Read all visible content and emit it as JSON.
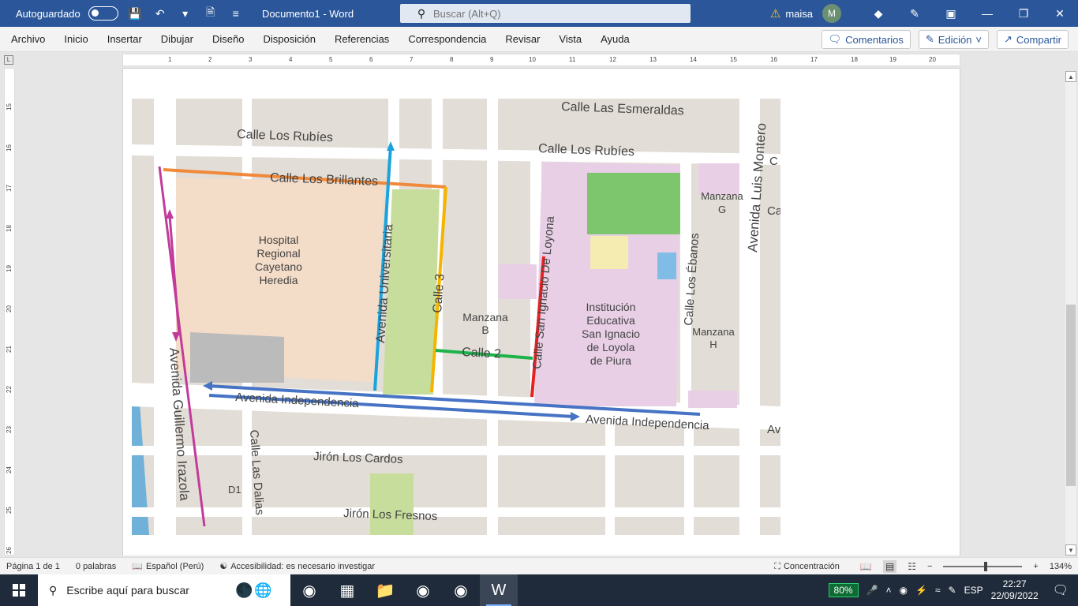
{
  "titlebar": {
    "autosave_label": "Autoguardado",
    "doc_title": "Documento1  -  Word",
    "search_placeholder": "Buscar (Alt+Q)",
    "user_name": "maisa",
    "avatar_initial": "M"
  },
  "ribbon": {
    "tabs": [
      "Archivo",
      "Inicio",
      "Insertar",
      "Dibujar",
      "Diseño",
      "Disposición",
      "Referencias",
      "Correspondencia",
      "Revisar",
      "Vista",
      "Ayuda"
    ],
    "comments_label": "Comentarios",
    "edit_label": "Edición",
    "share_label": "Compartir"
  },
  "ruler": {
    "h_numbers": [
      "1",
      "2",
      "3",
      "4",
      "5",
      "6",
      "7",
      "8",
      "9",
      "10",
      "11",
      "12",
      "13",
      "14",
      "15",
      "16",
      "17",
      "18",
      "19",
      "20"
    ],
    "v_numbers": [
      "15",
      "16",
      "17",
      "18",
      "19",
      "20",
      "21",
      "22",
      "23",
      "24",
      "25",
      "26"
    ]
  },
  "map": {
    "labels": {
      "esmeraldas": "Calle Las Esmeraldas",
      "rubies_1": "Calle Los Rubíes",
      "rubies_2": "Calle Los Rubíes",
      "brillantes": "Calle Los Brillantes",
      "hospital": [
        "Hospital",
        "Regional",
        "Cayetano",
        "Heredia"
      ],
      "universitaria": "Avenida Universitaria",
      "calle3": "Calle 3",
      "manzana_b": [
        "Manzana",
        "B"
      ],
      "calle2": "Calle 2",
      "san_ignacio_street": "Calle San Ignacio De Loyona",
      "institucion": [
        "Institución",
        "Educativa",
        "San Ignacio",
        "de Loyola",
        "de Piura"
      ],
      "ebanos": "Calle Los Ébanos",
      "manzana_g": [
        "Manzana",
        "G"
      ],
      "manzana_h": [
        "Manzana",
        "H"
      ],
      "luis_montero": "Avenida Luis Montero",
      "independencia_1": "Avenida Independencia",
      "independencia_2": "Avenida Independencia",
      "irazola": "Avenida Guillermo Irazola",
      "dalias": "Calle Las Dalias",
      "cardos": "Jirón Los Cardos",
      "fresnos": "Jirón Los Fresnos",
      "d1": "D1",
      "edge_c": "C",
      "edge_ca": "Ca",
      "edge_av": "Av"
    },
    "route_colors": {
      "orange": "#f0893a",
      "blue": "#1aa3dc",
      "yellow": "#f4b400",
      "green": "#1db34a",
      "red": "#e52222",
      "purple": "#c23a9a",
      "avenue_blue": "#4673c4"
    }
  },
  "statusbar": {
    "page": "Página 1 de 1",
    "words": "0 palabras",
    "language": "Español (Perú)",
    "accessibility": "Accesibilidad: es necesario investigar",
    "focus": "Concentración",
    "zoom": "134%"
  },
  "taskbar": {
    "search_placeholder": "Escribe aquí para buscar",
    "battery": "80%",
    "lang": "ESP",
    "time": "22:27",
    "date": "22/09/2022"
  }
}
